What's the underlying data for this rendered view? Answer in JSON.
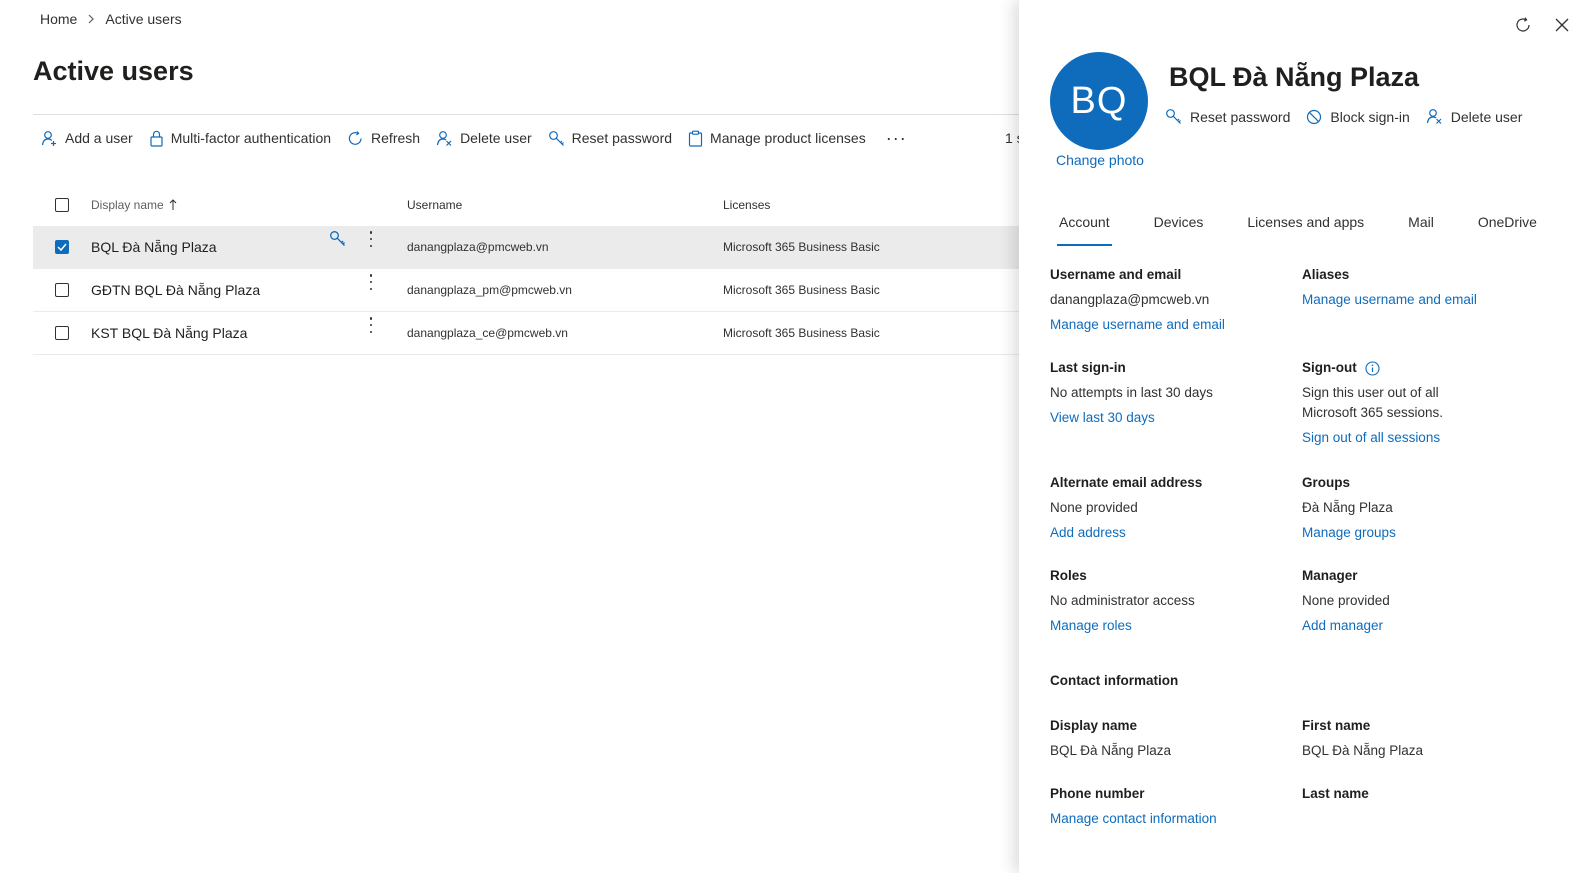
{
  "breadcrumb": {
    "home": "Home",
    "current": "Active users"
  },
  "page": {
    "title": "Active users",
    "count_text": "1 s"
  },
  "toolbar": {
    "add_user": "Add a user",
    "mfa": "Multi-factor authentication",
    "refresh": "Refresh",
    "delete_user": "Delete user",
    "reset_password": "Reset password",
    "manage_licenses": "Manage product licenses",
    "more": "···"
  },
  "table": {
    "headers": {
      "display_name": "Display name",
      "username": "Username",
      "licenses": "Licenses"
    },
    "rows": [
      {
        "name": "BQL Đà Nẵng Plaza",
        "username": "danangplaza@pmcweb.vn",
        "license": "Microsoft 365 Business Basic",
        "selected": true
      },
      {
        "name": "GĐTN BQL Đà Nẵng Plaza",
        "username": "danangplaza_pm@pmcweb.vn",
        "license": "Microsoft 365 Business Basic",
        "selected": false
      },
      {
        "name": "KST BQL Đà Nẵng Plaza",
        "username": "danangplaza_ce@pmcweb.vn",
        "license": "Microsoft 365 Business Basic",
        "selected": false
      }
    ]
  },
  "panel": {
    "initials": "BQ",
    "change_photo": "Change photo",
    "user_name": "BQL Đà Nẵng Plaza",
    "actions": {
      "reset_password": "Reset password",
      "block_signin": "Block sign-in",
      "delete_user": "Delete user"
    },
    "tabs": [
      "Account",
      "Devices",
      "Licenses and apps",
      "Mail",
      "OneDrive"
    ],
    "active_tab": "Account",
    "fields": {
      "username_email": {
        "label": "Username and email",
        "value": "danangplaza@pmcweb.vn",
        "link": "Manage username and email"
      },
      "aliases": {
        "label": "Aliases",
        "link": "Manage username and email"
      },
      "last_signin": {
        "label": "Last sign-in",
        "value": "No attempts in last 30 days",
        "link": "View last 30 days"
      },
      "signout": {
        "label": "Sign-out",
        "value_line1": "Sign this user out of all",
        "value_line2": "Microsoft 365 sessions.",
        "link": "Sign out of all sessions"
      },
      "alt_email": {
        "label": "Alternate email address",
        "value": "None provided",
        "link": "Add address"
      },
      "groups": {
        "label": "Groups",
        "value": "Đà Nẵng Plaza",
        "link": "Manage groups"
      },
      "roles": {
        "label": "Roles",
        "value": "No administrator access",
        "link": "Manage roles"
      },
      "manager": {
        "label": "Manager",
        "value": "None provided",
        "link": "Add manager"
      },
      "contact_heading": "Contact information",
      "display_name": {
        "label": "Display name",
        "value": "BQL Đà Nẵng Plaza"
      },
      "first_name": {
        "label": "First name",
        "value": "BQL Đà Nẵng Plaza"
      },
      "phone_number": {
        "label": "Phone number",
        "link": "Manage contact information"
      },
      "last_name": {
        "label": "Last name"
      }
    }
  },
  "colors": {
    "accent": "#0f6cbd",
    "selected_row": "#ebebeb",
    "text": "#323130"
  }
}
